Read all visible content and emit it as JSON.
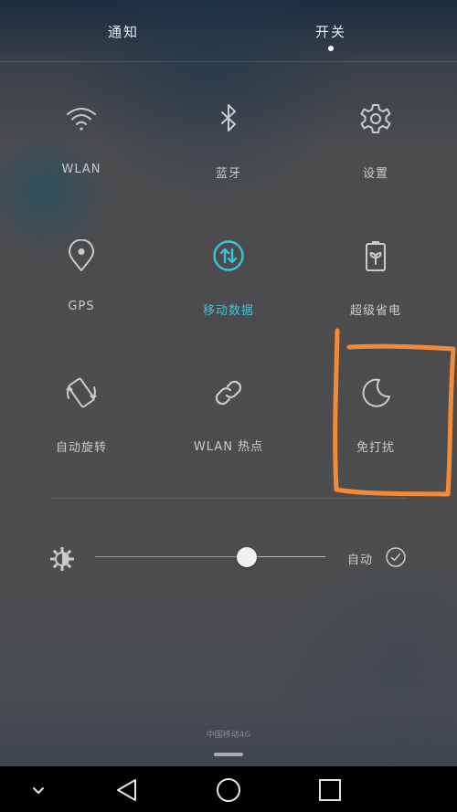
{
  "tabs": {
    "notify": "通知",
    "toggle": "开关",
    "active": "toggle"
  },
  "tiles": [
    {
      "label": "WLAN",
      "icon": "wifi-icon",
      "active": false
    },
    {
      "label": "蓝牙",
      "icon": "bluetooth-icon",
      "active": false
    },
    {
      "label": "设置",
      "icon": "gear-icon",
      "active": false
    },
    {
      "label": "GPS",
      "icon": "location-pin-icon",
      "active": false
    },
    {
      "label": "移动数据",
      "icon": "mobile-data-icon",
      "active": true
    },
    {
      "label": "超级省电",
      "icon": "battery-saver-icon",
      "active": false
    },
    {
      "label": "自动旋转",
      "icon": "auto-rotate-icon",
      "active": false
    },
    {
      "label": "WLAN 热点",
      "icon": "hotspot-icon",
      "active": false
    },
    {
      "label": "免打扰",
      "icon": "moon-icon",
      "active": false
    }
  ],
  "brightness": {
    "level": 0.66,
    "auto_label": "自动",
    "auto_checked": true
  },
  "carrier": "中国移动4G",
  "colors": {
    "accent": "#35c6dc",
    "label": "#c9cbcd",
    "annotation": "#f28a3a"
  },
  "navbar": [
    "chevron-down-icon",
    "back-triangle-icon",
    "home-circle-icon",
    "recents-square-icon"
  ]
}
